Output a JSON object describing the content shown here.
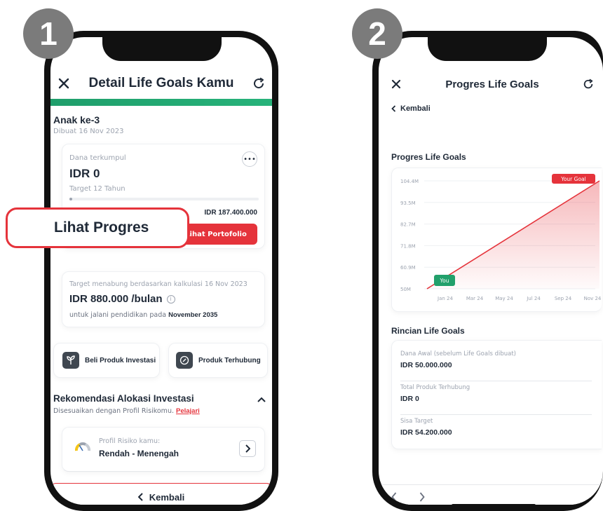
{
  "badges": [
    "1",
    "2"
  ],
  "screen1": {
    "title": "Detail Life Goals Kamu",
    "goal_name": "Anak ke-3",
    "created": "Dibuat 16 Nov 2023",
    "fund": {
      "label": "Dana terkumpul",
      "amount": "IDR 0",
      "target": "Target 12 Tahun",
      "goal_amount": "IDR 187.400.000",
      "progress": 0,
      "portfolio_button": "Lihat Portofolio"
    },
    "callout": "Lihat Progres",
    "saving": {
      "note": "Target menabung berdasarkan kalkulasi 16 Nov 2023",
      "amount": "IDR 880.000 /bulan",
      "purpose_prefix": "untuk jalani pendidikan pada ",
      "purpose_date": "November 2035"
    },
    "actions": [
      "Beli Produk Investasi",
      "Produk Terhubung"
    ],
    "recommendation": {
      "title": "Rekomendasi Alokasi Investasi",
      "subtitle": "Disesuaikan dengan Profil Risikomu. ",
      "link": "Pelajari",
      "risk_label": "Profil Risiko kamu:",
      "risk_value": "Rendah - Menengah"
    },
    "back_button": "Kembali"
  },
  "screen2": {
    "title": "Progres Life Goals",
    "back_link": "Kembali",
    "chart_title": "Progres Life Goals",
    "chart_data": {
      "type": "line",
      "x": [
        "Jan 24",
        "Mar 24",
        "May 24",
        "Jul 24",
        "Sep 24",
        "Nov 24"
      ],
      "y_ticks": [
        "104.4M",
        "93.5M",
        "82.7M",
        "71.8M",
        "60.9M",
        "50M"
      ],
      "ylim": [
        50,
        104.4
      ],
      "series": [
        {
          "values_start": 50,
          "values_end": 104.4
        }
      ],
      "annotations": [
        "Your Goal",
        "You"
      ],
      "grid": true
    },
    "details_title": "Rincian Life Goals",
    "details": [
      {
        "label": "Dana Awal (sebelum Life Goals dibuat)",
        "value": "IDR 50.000.000"
      },
      {
        "label": "Total Produk Terhubung",
        "value": "IDR 0"
      },
      {
        "label": "Sisa Target",
        "value": "IDR 54.200.000"
      }
    ]
  },
  "colors": {
    "brand_red": "#e5333b",
    "brand_green": "#22a06b",
    "badge_gray": "#7b7b7b"
  }
}
